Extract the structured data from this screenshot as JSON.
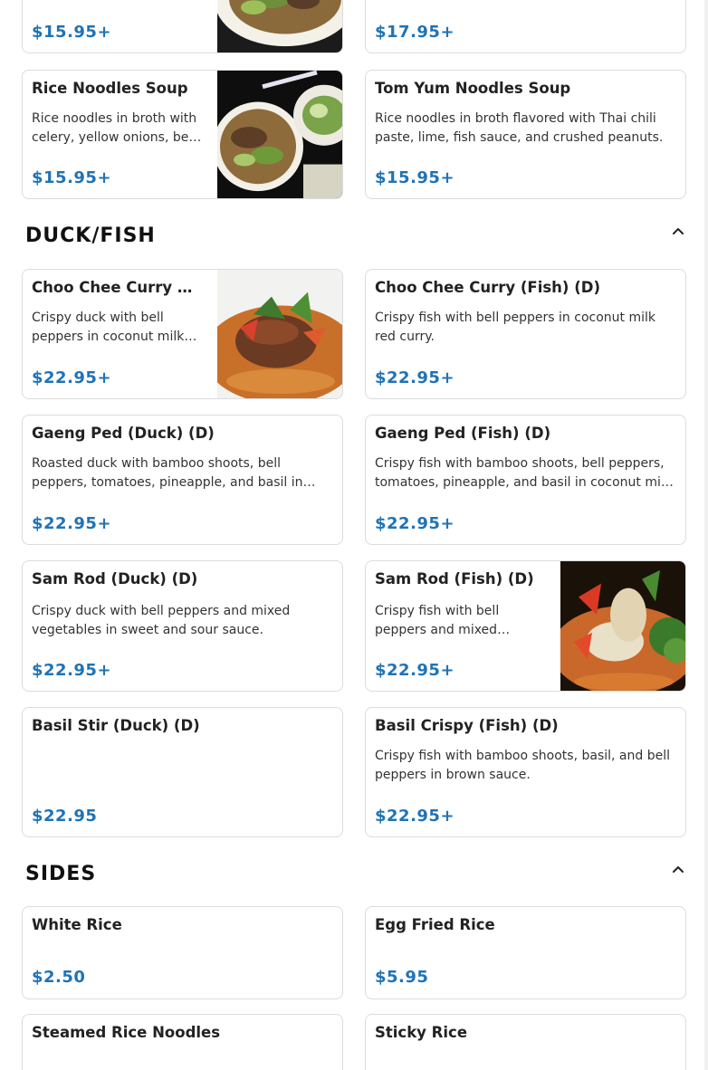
{
  "noodles_partial": {
    "left_price": "$15.95+",
    "right_price": "$17.95+"
  },
  "noodles": [
    {
      "name": "Rice Noodles Soup",
      "desc": "Rice noodles in broth with celery, yellow onions, bean sprouts, and green onions.",
      "price": "$15.95+"
    },
    {
      "name": "Tom Yum Noodles Soup",
      "desc": "Rice noodles in broth flavored with Thai chili paste, lime, fish sauce, and crushed peanuts.",
      "price": "$15.95+"
    }
  ],
  "duck_fish": {
    "title": "DUCK/FISH",
    "items": [
      {
        "name": "Choo Chee Curry (Duck) (D)",
        "desc": "Crispy duck with bell peppers in coconut milk red curry.",
        "price": "$22.95+"
      },
      {
        "name": "Choo Chee Curry (Fish) (D)",
        "desc": "Crispy fish with bell peppers in coconut milk red curry.",
        "price": "$22.95+"
      },
      {
        "name": "Gaeng Ped (Duck) (D)",
        "desc": "Roasted duck with bamboo shoots, bell peppers, tomatoes, pineapple, and basil in coconut milk red curry.",
        "price": "$22.95+"
      },
      {
        "name": "Gaeng Ped (Fish) (D)",
        "desc": "Crispy fish with bamboo shoots, bell peppers, tomatoes, pineapple, and basil in coconut milk red curry.",
        "price": "$22.95+"
      },
      {
        "name": "Sam Rod (Duck) (D)",
        "desc": "Crispy duck with bell peppers and mixed vegetables in sweet and sour sauce.",
        "price": "$22.95+"
      },
      {
        "name": "Sam Rod (Fish) (D)",
        "desc": "Crispy fish with bell peppers and mixed vegetables in sweet and sour sauce.",
        "price": "$22.95+"
      },
      {
        "name": "Basil Stir (Duck) (D)",
        "desc": "",
        "price": "$22.95"
      },
      {
        "name": "Basil Crispy (Fish) (D)",
        "desc": "Crispy fish with bamboo shoots, basil, and bell peppers in brown sauce.",
        "price": "$22.95+"
      }
    ]
  },
  "sides": {
    "title": "SIDES",
    "items": [
      {
        "name": "White Rice",
        "price": "$2.50"
      },
      {
        "name": "Egg Fried Rice",
        "price": "$5.95"
      },
      {
        "name": "Steamed Rice Noodles",
        "price": ""
      },
      {
        "name": "Sticky Rice",
        "price": ""
      }
    ]
  },
  "colors": {
    "price": "#1f73b7",
    "border": "#dcdcdc"
  }
}
